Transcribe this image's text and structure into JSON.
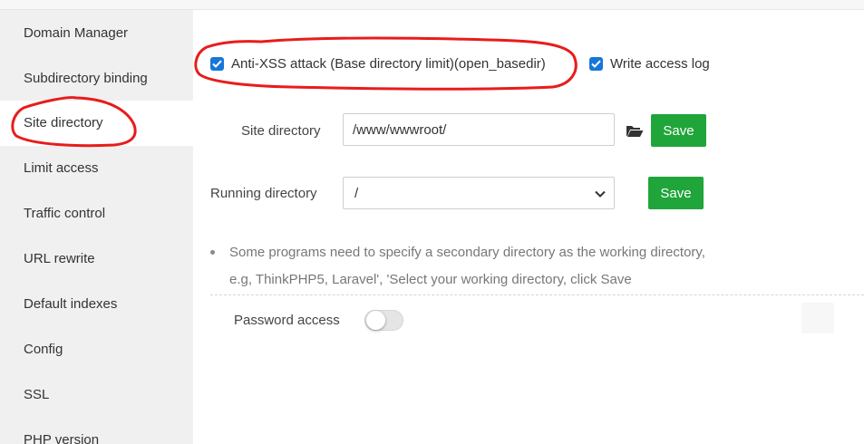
{
  "sidebar": {
    "items": [
      {
        "label": "Domain Manager",
        "active": false
      },
      {
        "label": "Subdirectory binding",
        "active": false
      },
      {
        "label": "Site directory",
        "active": true
      },
      {
        "label": "Limit access",
        "active": false
      },
      {
        "label": "Traffic control",
        "active": false
      },
      {
        "label": "URL rewrite",
        "active": false
      },
      {
        "label": "Default indexes",
        "active": false
      },
      {
        "label": "Config",
        "active": false
      },
      {
        "label": "SSL",
        "active": false
      },
      {
        "label": "PHP version",
        "active": false
      }
    ]
  },
  "options": {
    "anti_xss_label": "Anti-XSS attack (Base directory limit)(open_basedir)",
    "anti_xss_checked": true,
    "access_log_label": "Write access log",
    "access_log_checked": true
  },
  "site_directory": {
    "label": "Site directory",
    "value": "/www/wwwroot/",
    "save_label": "Save"
  },
  "running_directory": {
    "label": "Running directory",
    "selected": "/",
    "save_label": "Save"
  },
  "tips": [
    "Some programs need to specify a secondary directory as the working directory,",
    "e.g, ThinkPHP5, Laravel', 'Select your working directory, click Save"
  ],
  "password_access": {
    "label": "Password access",
    "enabled": false
  },
  "colors": {
    "accent_green": "#20a53a",
    "checkbox_blue": "#1677d9",
    "annotation_red": "#e81c1c"
  }
}
